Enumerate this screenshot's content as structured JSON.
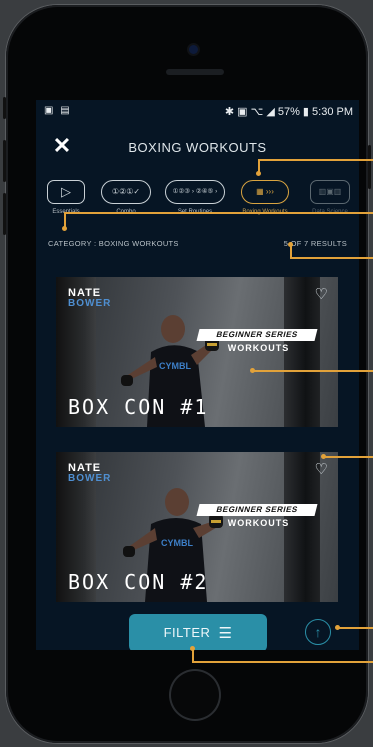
{
  "status_bar": {
    "left_icons": "▣ ▤",
    "right": "✱ ▣ ⌥ ◢ 57% ▮ 5:30 PM"
  },
  "header": {
    "close_icon": "close-icon",
    "title": "BOXING WORKOUTS"
  },
  "categories": [
    {
      "label": "Essentials",
      "icon": "play-icon",
      "glyph": "▷"
    },
    {
      "label": "Combo",
      "icon": "combo-icon",
      "glyph": "①②①✓"
    },
    {
      "label": "Set Routines",
      "icon": "set-routines-icon",
      "glyph": "①②③ › ②④⑤ ›"
    },
    {
      "label": "Boxing Workouts",
      "icon": "boxing-workouts-icon",
      "glyph": "▦ ›››"
    },
    {
      "label": "Data Science",
      "icon": "data-science-icon",
      "glyph": "▥▣▥"
    }
  ],
  "filter_meta": {
    "category": "CATEGORY : BOXING WORKOUTS",
    "results": "5 OF 7 RESULTS"
  },
  "cards": [
    {
      "trainer_first": "NATE",
      "trainer_last": "BOWER",
      "series": "BEGINNER SERIES",
      "subtitle": "WORKOUTS",
      "title": "BOX CON #1"
    },
    {
      "trainer_first": "NATE",
      "trainer_last": "BOWER",
      "series": "BEGINNER SERIES",
      "subtitle": "WORKOUTS",
      "title": "BOX CON #2"
    }
  ],
  "filter_button": {
    "label": "FILTER",
    "icon": "sliders-icon"
  },
  "scroll_top": {
    "icon": "arrow-up-icon"
  },
  "colors": {
    "accent": "#2a8fa7",
    "active": "#d9a441",
    "background": "#061524"
  }
}
